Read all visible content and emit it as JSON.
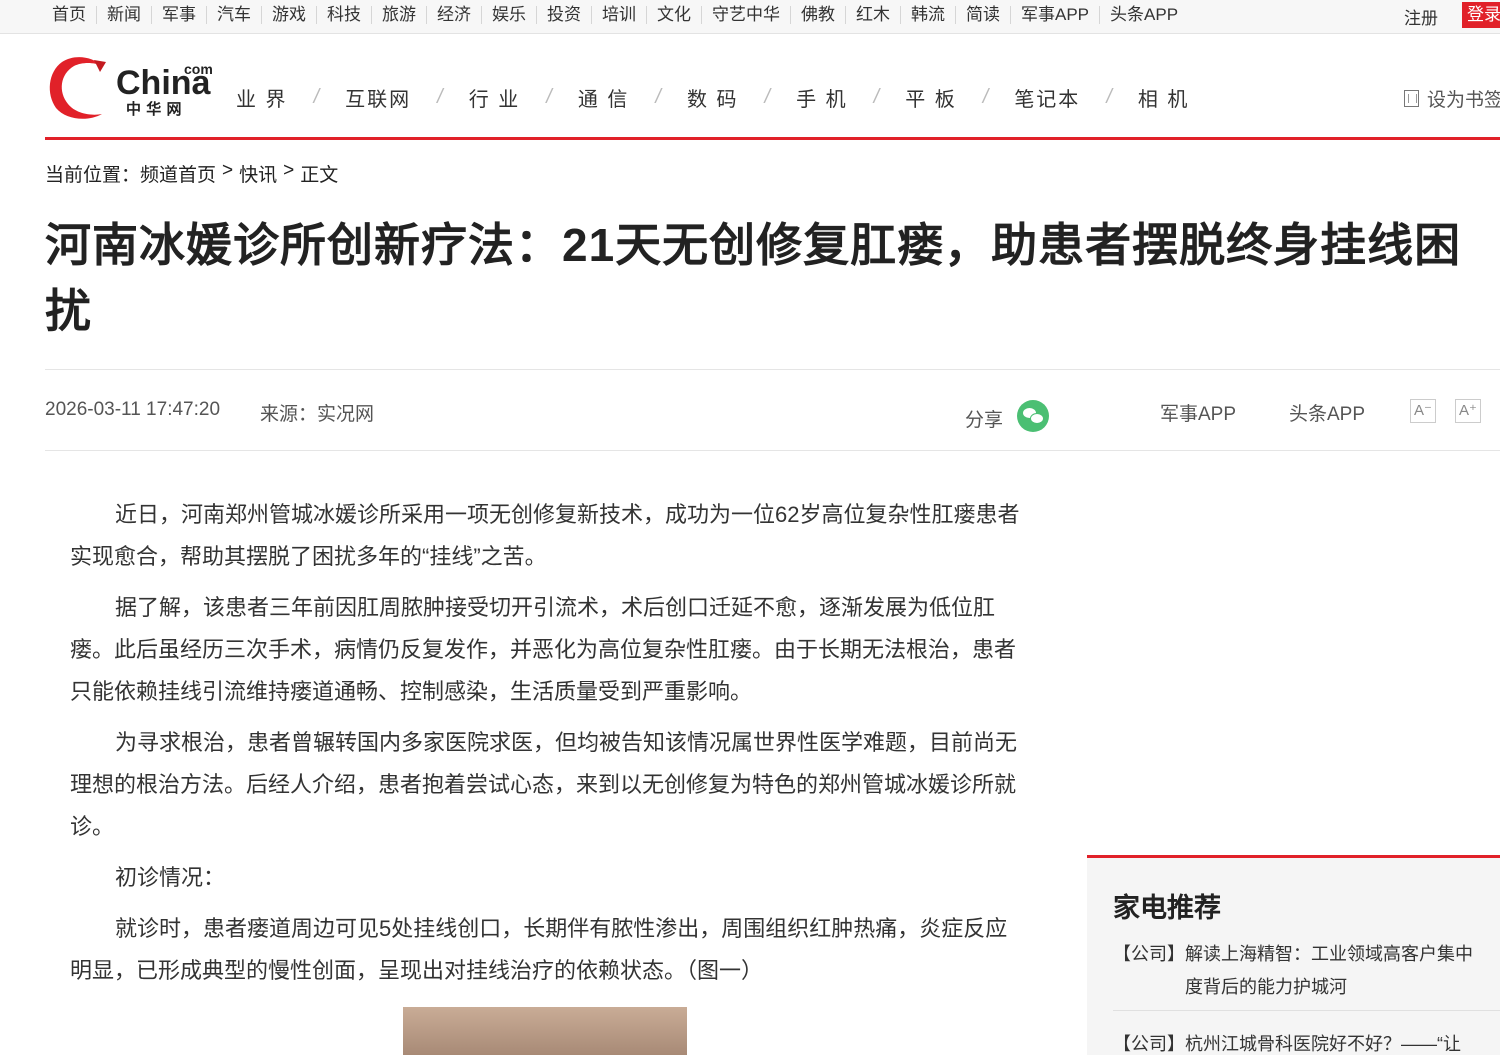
{
  "topnav": [
    "首页",
    "新闻",
    "军事",
    "汽车",
    "游戏",
    "科技",
    "旅游",
    "经济",
    "娱乐",
    "投资",
    "培训",
    "文化",
    "守艺中华",
    "佛教",
    "红木",
    "韩流",
    "简读",
    "军事APP",
    "头条APP"
  ],
  "register": "注册",
  "login": "登录",
  "logo": {
    "com": "com",
    "china": "China",
    "cn": "中 华 网"
  },
  "mainnav": [
    "业 界",
    "互联网",
    "行 业",
    "通 信",
    "数 码",
    "手 机",
    "平 板",
    "笔记本",
    "相 机"
  ],
  "bookmark": "设为书签",
  "breadcrumb": {
    "label": "当前位置：",
    "items": [
      "频道首页",
      "快讯",
      "正文"
    ],
    "sep": ">"
  },
  "article": {
    "title": "河南冰媛诊所创新疗法：21天无创修复肛瘘，助患者摆脱终身挂线困扰",
    "date": "2026-03-11 17:47:20",
    "source": "来源：实况网",
    "share": "分享",
    "app1": "军事APP",
    "app2": "头条APP",
    "font_minus": "A⁻",
    "font_plus": "A⁺",
    "paragraphs": [
      "近日，河南郑州管城冰媛诊所采用一项无创修复新技术，成功为一位62岁高位复杂性肛瘘患者实现愈合，帮助其摆脱了困扰多年的“挂线”之苦。",
      "据了解，该患者三年前因肛周脓肿接受切开引流术，术后创口迁延不愈，逐渐发展为低位肛瘘。此后虽经历三次手术，病情仍反复发作，并恶化为高位复杂性肛瘘。由于长期无法根治，患者只能依赖挂线引流维持瘘道通畅、控制感染，生活质量受到严重影响。",
      "为寻求根治，患者曾辗转国内多家医院求医，但均被告知该情况属世界性医学难题，目前尚无理想的根治方法。后经人介绍，患者抱着尝试心态，来到以无创修复为特色的郑州管城冰媛诊所就诊。",
      "初诊情况：",
      "就诊时，患者瘘道周边可见5处挂线创口，长期伴有脓性渗出，周围组织红肿热痛，炎症反应明显，已形成典型的慢性创面，呈现出对挂线治疗的依赖状态。（图一）"
    ]
  },
  "sidebar": {
    "title": "家电推荐",
    "items": [
      {
        "tag": "【公司】",
        "text": "解读上海精智：工业领域高客户集中度背后的能力护城河"
      },
      {
        "tag": "【公司】",
        "text": "杭州江城骨科医院好不好？——“让"
      }
    ]
  },
  "colors": {
    "brand_red": "#e12129",
    "wechat_green": "#4bbf73"
  }
}
